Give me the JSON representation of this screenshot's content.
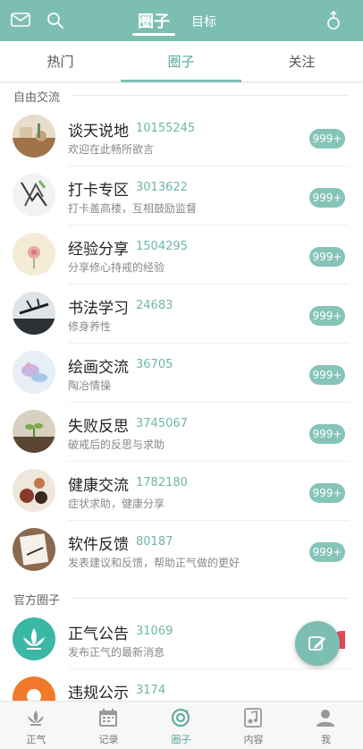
{
  "header": {
    "tab_main": "圈子",
    "tab_target": "目标"
  },
  "subtabs": [
    "热门",
    "圈子",
    "关注"
  ],
  "sections": {
    "free": "自由交流",
    "official": "官方圈子"
  },
  "items": [
    {
      "name": "谈天说地",
      "count": "10155245",
      "desc": "欢迎在此畅所欲言",
      "badge": "999+"
    },
    {
      "name": "打卡专区",
      "count": "3013622",
      "desc": "打卡盖高楼，互相鼓励监督",
      "badge": "999+"
    },
    {
      "name": "经验分享",
      "count": "1504295",
      "desc": "分享修心持戒的经验",
      "badge": "999+"
    },
    {
      "name": "书法学习",
      "count": "24683",
      "desc": "修身养性",
      "badge": "999+"
    },
    {
      "name": "绘画交流",
      "count": "36705",
      "desc": "陶冶情操",
      "badge": "999+"
    },
    {
      "name": "失败反思",
      "count": "3745067",
      "desc": "破戒后的反思与求助",
      "badge": "999+"
    },
    {
      "name": "健康交流",
      "count": "1782180",
      "desc": "症状求助，健康分享",
      "badge": "999+"
    },
    {
      "name": "软件反馈",
      "count": "80187",
      "desc": "发表建议和反馈，帮助正气做的更好",
      "badge": "999+"
    }
  ],
  "official_items": [
    {
      "name": "正气公告",
      "count": "31069",
      "desc": "发布正气的最新消息"
    },
    {
      "name": "违规公示",
      "count": "3174"
    }
  ],
  "bottomnav": [
    "正气",
    "记录",
    "圈子",
    "内容",
    "我"
  ],
  "colors": {
    "accent": "#7cbfb2",
    "badge": "#86c4b8",
    "alert": "#e84a5a"
  }
}
